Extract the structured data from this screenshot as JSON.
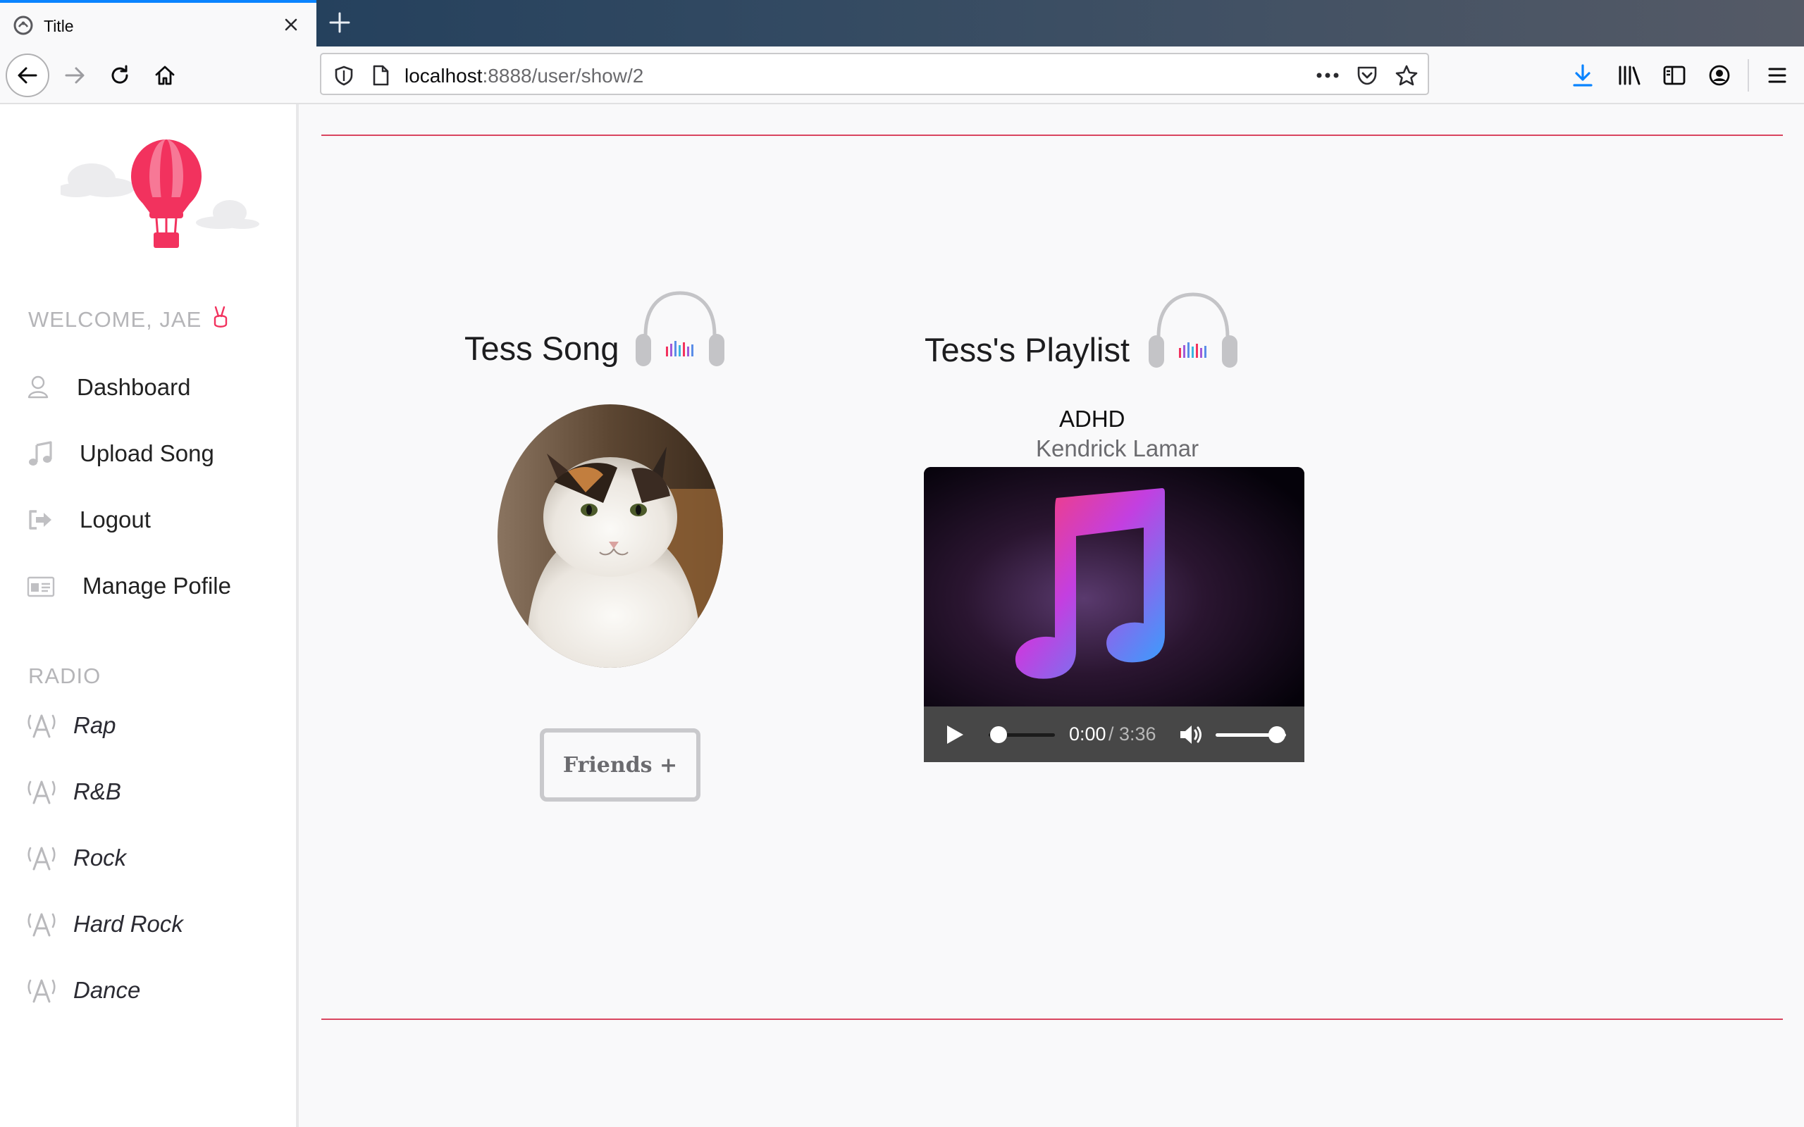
{
  "browser": {
    "tab_title": "Title",
    "url_host": "localhost",
    "url_rest": ":8888/user/show/2"
  },
  "sidebar": {
    "welcome": "WELCOME, JAE",
    "menu": [
      {
        "label": "Dashboard",
        "icon": "user-icon"
      },
      {
        "label": "Upload Song",
        "icon": "music-note-icon"
      },
      {
        "label": "Logout",
        "icon": "logout-icon"
      },
      {
        "label": "Manage Pofile",
        "icon": "id-card-icon"
      }
    ],
    "radio_heading": "RADIO",
    "radio": [
      {
        "label": "Rap",
        "icon": "radio-tower-icon"
      },
      {
        "label": "R&B",
        "icon": "radio-tower-icon"
      },
      {
        "label": "Rock",
        "icon": "radio-tower-icon"
      },
      {
        "label": "Hard Rock",
        "icon": "radio-tower-icon"
      },
      {
        "label": "Dance",
        "icon": "radio-tower-icon"
      }
    ]
  },
  "profile": {
    "title": "Tess Song",
    "friends_button": "Friends +"
  },
  "playlist": {
    "title": "Tess's Playlist",
    "song": "ADHD",
    "artist": "Kendrick Lamar",
    "player": {
      "current_time": "0:00",
      "total_time": "/ 3:36",
      "progress": 0,
      "volume": 1
    }
  },
  "colors": {
    "accent": "#d9455f",
    "balloon": "#f2325e",
    "sidebar_muted": "#b5b5b8"
  }
}
